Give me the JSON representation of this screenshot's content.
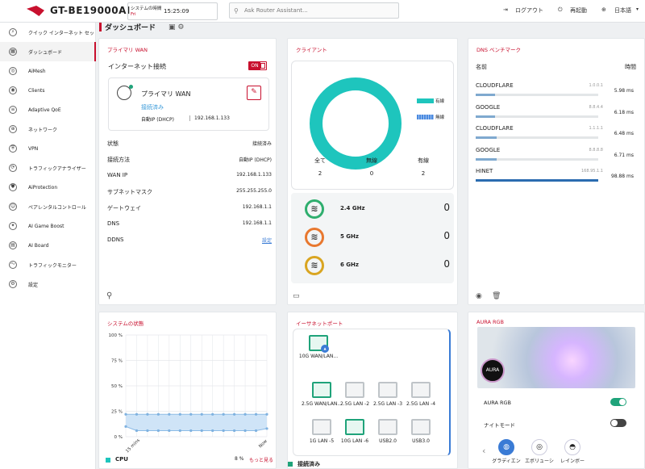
{
  "app": {
    "model": "GT-BE19000AI",
    "sys_label": "システムの時間",
    "sys_day": "Fri",
    "sys_time": "15:25:09",
    "search_placeholder": "Ask Router Assistant...",
    "logout": "ログアウト",
    "reboot": "再起動",
    "language": "日本語"
  },
  "sidebar": {
    "items": [
      {
        "label": "クイック インターネット セッ",
        "icon": "wand-icon"
      },
      {
        "label": "ダッシュボード",
        "icon": "dashboard-icon"
      },
      {
        "label": "AiMesh",
        "icon": "mesh-icon"
      },
      {
        "label": "Clients",
        "icon": "clients-icon"
      },
      {
        "label": "Adaptive QoE",
        "icon": "qos-icon"
      },
      {
        "label": "ネットワーク",
        "icon": "globe-icon"
      },
      {
        "label": "VPN",
        "icon": "vpn-icon"
      },
      {
        "label": "トラフィックアナライザー",
        "icon": "analyzer-icon"
      },
      {
        "label": "AiProtection",
        "icon": "shield-icon"
      },
      {
        "label": "ペアレンタルコントロール",
        "icon": "family-icon"
      },
      {
        "label": "AI Game Boost",
        "icon": "gamepad-icon"
      },
      {
        "label": "AI Board",
        "icon": "board-icon"
      },
      {
        "label": "トラフィックモニター",
        "icon": "monitor-icon"
      },
      {
        "label": "設定",
        "icon": "gear-icon"
      }
    ]
  },
  "dashboard": {
    "title": "ダッシュボード"
  },
  "wan": {
    "title": "プライマリ WAN",
    "internet_label": "インターネット接続",
    "toggle": "ON",
    "primary": "プライマリ WAN",
    "connected": "接続済み",
    "auto_ip": "自動IP (DHCP)",
    "auto_ip_value": "192.168.1.133",
    "rows": [
      {
        "k": "状態",
        "v": "接続済み"
      },
      {
        "k": "接続方法",
        "v": "自動IP (DHCP)"
      },
      {
        "k": "WAN IP",
        "v": "192.168.1.133"
      },
      {
        "k": "サブネットマスク",
        "v": "255.255.255.0"
      },
      {
        "k": "ゲートウェイ",
        "v": "192.168.1.1"
      },
      {
        "k": "DNS",
        "v": "192.168.1.1"
      },
      {
        "k": "DDNS",
        "v": "設定"
      }
    ]
  },
  "clients": {
    "title": "クライアント",
    "wired_label": "有線",
    "wireless_label": "無線",
    "all_label": "全て",
    "all": "2",
    "wireless": "0",
    "wired": "2",
    "bands": [
      {
        "name": "2.4 GHz",
        "count": "0",
        "color": "#2fae6e"
      },
      {
        "name": "5 GHz",
        "count": "0",
        "color": "#e8782f"
      },
      {
        "name": "6 GHz",
        "count": "0",
        "color": "#d9a521"
      }
    ]
  },
  "dns": {
    "title": "DNS ベンチマーク",
    "name_header": "名前",
    "time_header": "時間",
    "rows": [
      {
        "name": "CLOUDFLARE",
        "ip": "1.0.0.1",
        "ms": "5.98 ms",
        "fill": 0.16
      },
      {
        "name": "GOOGLE",
        "ip": "8.8.4.4",
        "ms": "6.18 ms",
        "fill": 0.16
      },
      {
        "name": "CLOUDFLARE",
        "ip": "1.1.1.1",
        "ms": "6.48 ms",
        "fill": 0.17
      },
      {
        "name": "GOOGLE",
        "ip": "8.8.8.8",
        "ms": "6.71 ms",
        "fill": 0.17
      },
      {
        "name": "HINET",
        "ip": "168.95.1.1",
        "ms": "98.88 ms",
        "fill": 1.0
      }
    ]
  },
  "system": {
    "title": "システムの状態",
    "yticks": [
      "100 %",
      "75 %",
      "50 %",
      "25 %",
      "0 %"
    ],
    "x_start": "15 mins",
    "x_end": "Now",
    "cpu_label": "CPU",
    "cpu_value": "8 %",
    "more": "もっと見る"
  },
  "ethernet": {
    "title": "イーサネットポート",
    "wan_port": "10G WAN/LAN...",
    "ports": [
      "2.5G WAN/LAN...",
      "2.5G LAN -2",
      "2.5G LAN -3",
      "2.5G LAN -4",
      "1G LAN -5",
      "10G LAN -6",
      "USB2.0",
      "USB3.0"
    ],
    "status": "接続済み"
  },
  "aura": {
    "title": "AURA RGB",
    "badge": "AURA",
    "aura_rgb": "AURA RGB",
    "night_mode": "ナイトモード",
    "modes": [
      "グラディエン",
      "エボリューシ",
      "レインボー"
    ]
  },
  "chart_data": {
    "type": "area",
    "title": "システムの状態",
    "series": [
      {
        "name": "CPU",
        "values": [
          22,
          22,
          22,
          22,
          22,
          22,
          22,
          22,
          22,
          22,
          22,
          22,
          22,
          22
        ]
      },
      {
        "name": "",
        "values": [
          10,
          6,
          6,
          6,
          6,
          6,
          6,
          6,
          6,
          6,
          6,
          6,
          6,
          8
        ]
      }
    ],
    "ylim": [
      0,
      100
    ],
    "x_labels": [
      "15 mins",
      "Now"
    ]
  }
}
